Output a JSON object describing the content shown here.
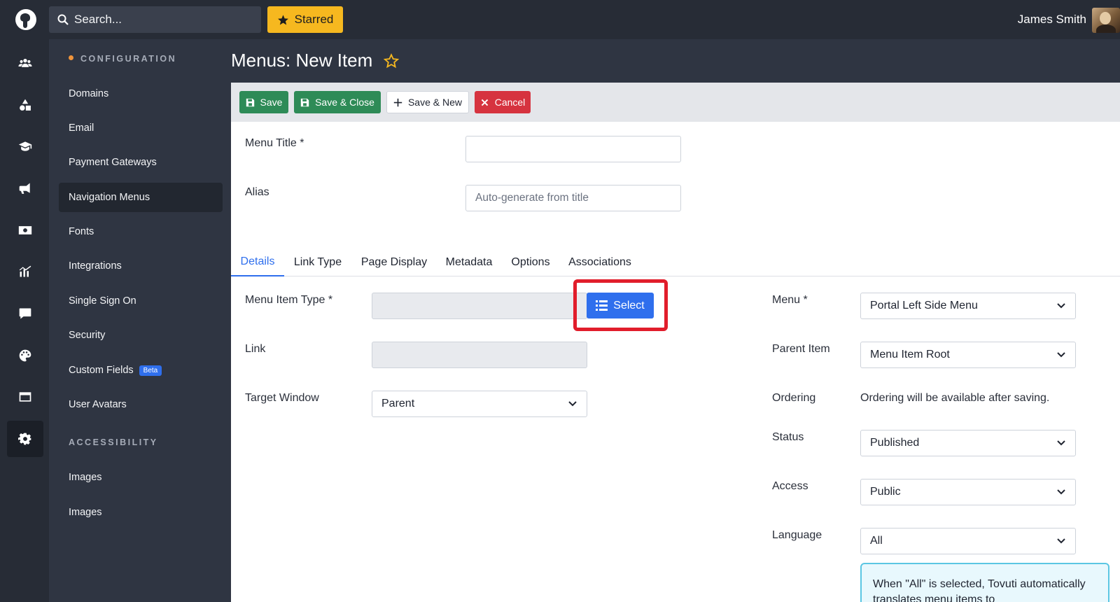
{
  "topbar": {
    "search_placeholder": "Search...",
    "starred_label": "Starred",
    "user_name": "James Smith"
  },
  "rail": {
    "icons": [
      "users-icon",
      "shapes-icon",
      "graduation-cap-icon",
      "megaphone-icon",
      "money-icon",
      "chart-icon",
      "chat-icon",
      "palette-icon",
      "window-icon",
      "gear-icon"
    ],
    "active": "gear-icon"
  },
  "sidebar": {
    "section1": "CONFIGURATION",
    "items": [
      {
        "label": "Domains"
      },
      {
        "label": "Email"
      },
      {
        "label": "Payment Gateways"
      },
      {
        "label": "Navigation Menus",
        "active": true
      },
      {
        "label": "Fonts"
      },
      {
        "label": "Integrations"
      },
      {
        "label": "Single Sign On"
      },
      {
        "label": "Security"
      },
      {
        "label": "Custom Fields",
        "badge": "Beta"
      },
      {
        "label": "User Avatars"
      }
    ],
    "section2": "ACCESSIBILITY",
    "items2": [
      {
        "label": "Images"
      },
      {
        "label": "Images"
      }
    ]
  },
  "page": {
    "title": "Menus: New Item"
  },
  "toolbar": {
    "save": "Save",
    "save_close": "Save & Close",
    "save_new": "Save & New",
    "cancel": "Cancel"
  },
  "form": {
    "menu_title_label": "Menu Title *",
    "menu_title_value": "",
    "alias_label": "Alias",
    "alias_placeholder": "Auto-generate from title",
    "tabs": [
      "Details",
      "Link Type",
      "Page Display",
      "Metadata",
      "Options",
      "Associations"
    ],
    "active_tab": "Details",
    "menu_item_type_label": "Menu Item Type *",
    "select_button": "Select",
    "link_label": "Link",
    "target_window_label": "Target Window",
    "target_window_value": "Parent",
    "menu_label": "Menu *",
    "menu_value": "Portal Left Side Menu",
    "parent_item_label": "Parent Item",
    "parent_item_value": "Menu Item Root",
    "ordering_label": "Ordering",
    "ordering_note": "Ordering will be available after saving.",
    "status_label": "Status",
    "status_value": "Published",
    "access_label": "Access",
    "access_value": "Public",
    "language_label": "Language",
    "language_value": "All",
    "info_text": "When \"All\" is selected, Tovuti automatically translates menu items to"
  },
  "colors": {
    "accent": "#2f6fed",
    "save_green": "#2e8b57",
    "cancel_red": "#d6333f",
    "starred_yellow": "#f6b81f",
    "highlight_red": "#e11d2b"
  }
}
